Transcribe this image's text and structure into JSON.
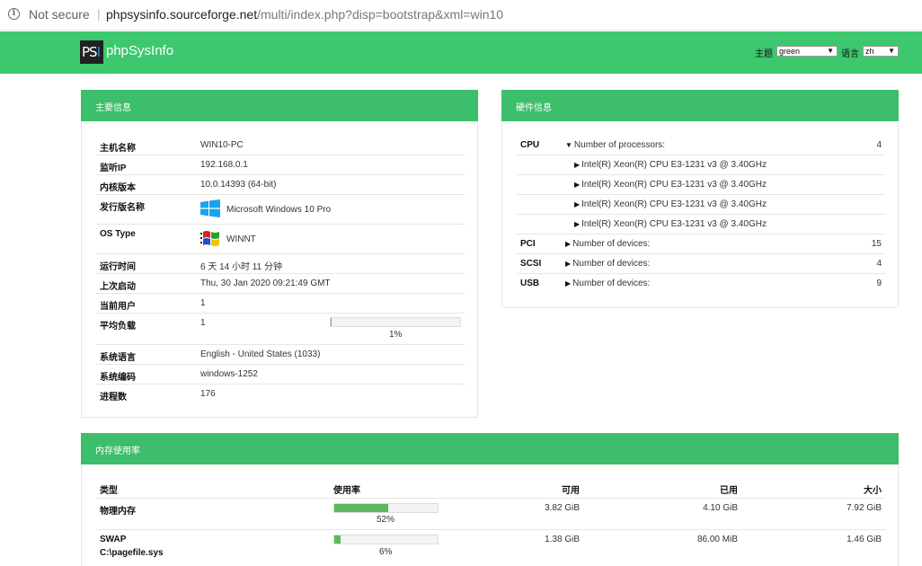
{
  "browser": {
    "security": "Not secure",
    "host": "phpsysinfo.sourceforge.net",
    "path": "/multi/index.php?disp=bootstrap&xml=win10"
  },
  "navbar": {
    "logo_text": "PSI",
    "brand": "phpSysInfo",
    "theme_label": "主题",
    "theme_value": "green",
    "lang_label": "语言",
    "lang_value": "zh"
  },
  "main_info": {
    "title": "主要信息",
    "rows": [
      {
        "label": "主机名称",
        "value": "WIN10-PC"
      },
      {
        "label": "监听IP",
        "value": "192.168.0.1"
      },
      {
        "label": "内核版本",
        "value": "10.0.14393 (64-bit)"
      },
      {
        "label": "发行版名称",
        "value": "Microsoft Windows 10 Pro",
        "icon": "windows10-logo-icon"
      },
      {
        "label": "OS Type",
        "value": "WINNT",
        "icon": "windows-nt-logo-icon"
      },
      {
        "label": "运行时间",
        "value": "6 天 14 小时 11 分钟"
      },
      {
        "label": "上次启动",
        "value": "Thu, 30 Jan 2020 09:21:49 GMT"
      },
      {
        "label": "当前用户",
        "value": "1"
      },
      {
        "label": "平均负载",
        "value": "1",
        "percent_text": "1%",
        "percent": 1
      },
      {
        "label": "系统语言",
        "value": "English - United States (1033)"
      },
      {
        "label": "系统编码",
        "value": "windows-1252"
      },
      {
        "label": "进程数",
        "value": "176"
      }
    ]
  },
  "hardware": {
    "title": "硬件信息",
    "cpu": {
      "label": "CPU",
      "text": "Number of processors:",
      "count": "4",
      "processors": [
        "Intel(R) Xeon(R) CPU E3-1231 v3 @ 3.40GHz",
        "Intel(R) Xeon(R) CPU E3-1231 v3 @ 3.40GHz",
        "Intel(R) Xeon(R) CPU E3-1231 v3 @ 3.40GHz",
        "Intel(R) Xeon(R) CPU E3-1231 v3 @ 3.40GHz"
      ]
    },
    "devices": [
      {
        "label": "PCI",
        "text": "Number of devices:",
        "count": "15"
      },
      {
        "label": "SCSI",
        "text": "Number of devices:",
        "count": "4"
      },
      {
        "label": "USB",
        "text": "Number of devices:",
        "count": "9"
      }
    ]
  },
  "memory": {
    "title": "内存使用率",
    "headers": {
      "type": "类型",
      "usage": "使用率",
      "free": "可用",
      "used": "已用",
      "size": "大小"
    },
    "rows": [
      {
        "type": "物理内存",
        "subtype": "",
        "percent": 52,
        "percent_text": "52%",
        "free": "3.82 GiB",
        "used": "4.10 GiB",
        "size": "7.92 GiB"
      },
      {
        "type": "SWAP",
        "subtype": "C:\\pagefile.sys",
        "percent": 6,
        "percent_text": "6%",
        "free": "1.38 GiB",
        "used": "86.00 MiB",
        "size": "1.46 GiB"
      }
    ]
  },
  "colors": {
    "navbar": "#3dc86f",
    "panel_header": "#3dbe6a",
    "bar_fill": "#5cb85c"
  }
}
